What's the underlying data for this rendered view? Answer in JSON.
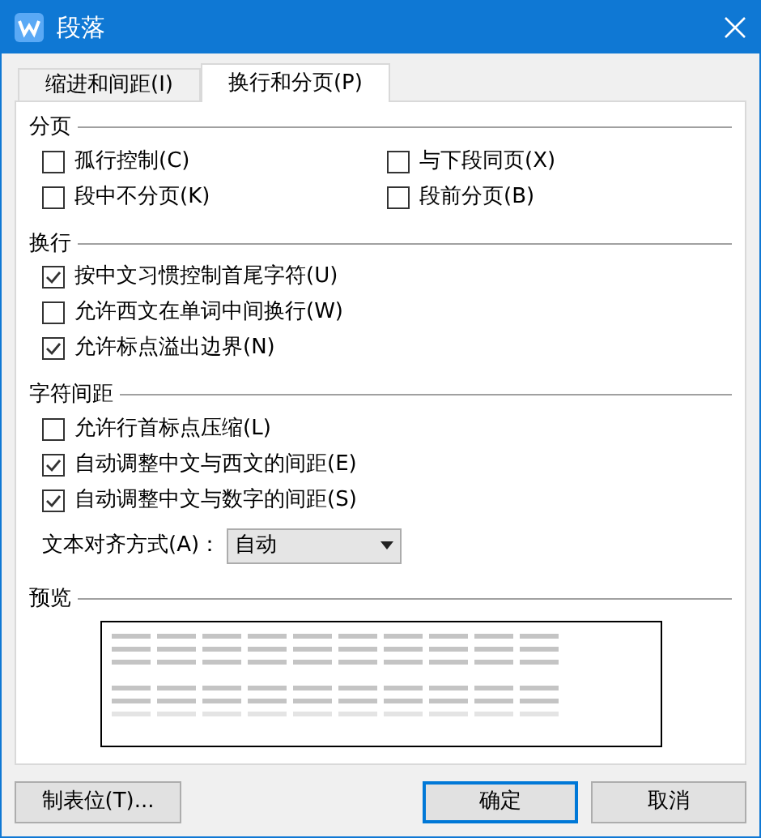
{
  "window": {
    "title": "段落"
  },
  "tabs": [
    {
      "label": "缩进和间距(I)",
      "selected": false
    },
    {
      "label": "换行和分页(P)",
      "selected": true
    }
  ],
  "sections": [
    {
      "title": "分页",
      "kind": "grid",
      "options": [
        {
          "label": "孤行控制(C)",
          "checked": false
        },
        {
          "label": "与下段同页(X)",
          "checked": false
        },
        {
          "label": "段中不分页(K)",
          "checked": false
        },
        {
          "label": "段前分页(B)",
          "checked": false
        }
      ]
    },
    {
      "title": "换行",
      "kind": "list",
      "options": [
        {
          "label": "按中文习惯控制首尾字符(U)",
          "checked": true
        },
        {
          "label": "允许西文在单词中间换行(W)",
          "checked": false
        },
        {
          "label": "允许标点溢出边界(N)",
          "checked": true
        }
      ]
    },
    {
      "title": "字符间距",
      "kind": "list",
      "options": [
        {
          "label": "允许行首标点压缩(L)",
          "checked": false
        },
        {
          "label": "自动调整中文与西文的间距(E)",
          "checked": true
        },
        {
          "label": "自动调整中文与数字的间距(S)",
          "checked": true
        }
      ]
    }
  ],
  "alignment": {
    "label": "文本对齐方式(A)：",
    "value": "自动"
  },
  "preview": {
    "title": "预览"
  },
  "buttons": [
    {
      "label": "制表位(T)...",
      "kind": "secondary"
    },
    {
      "label": "确定",
      "kind": "default"
    },
    {
      "label": "取消",
      "kind": "secondary"
    }
  ]
}
